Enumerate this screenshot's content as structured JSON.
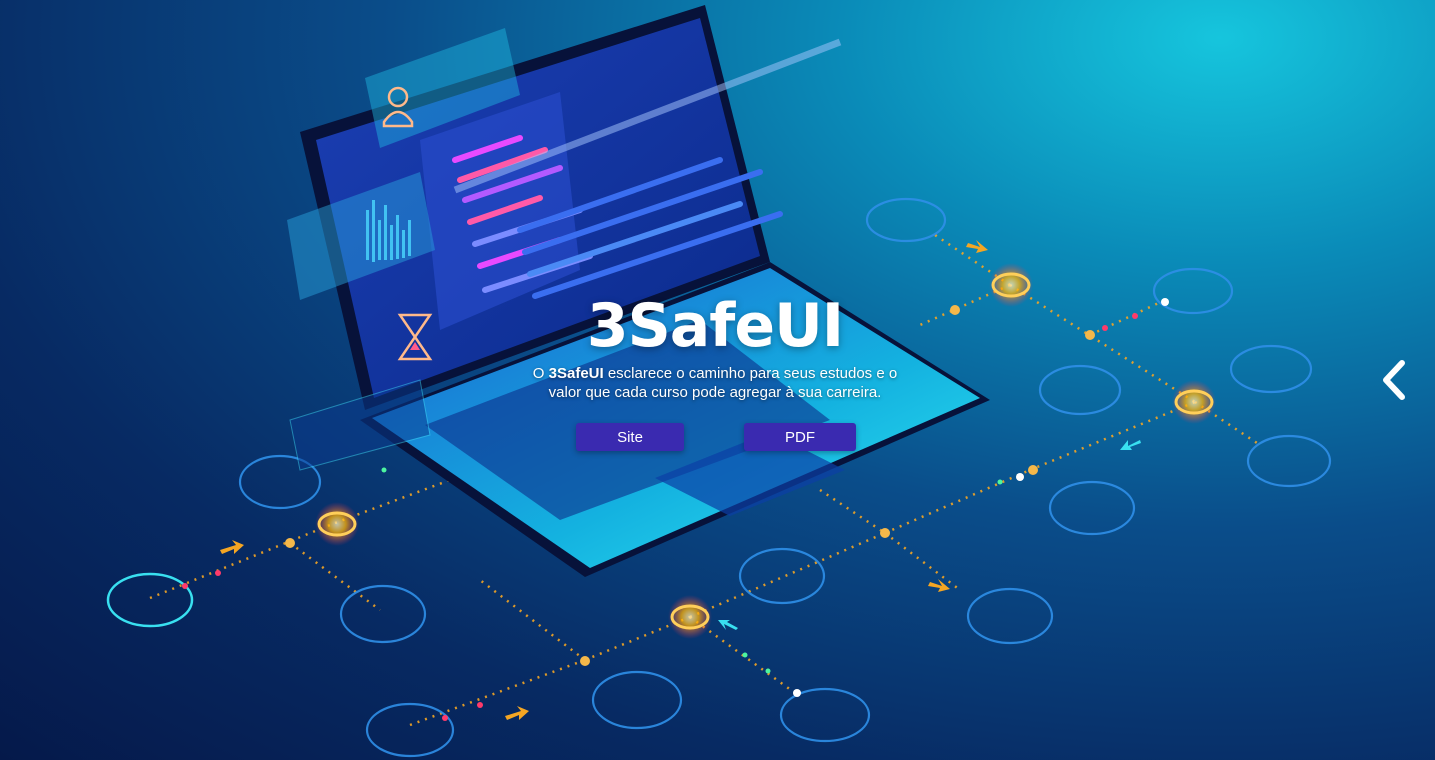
{
  "hero": {
    "title": "3SafeUI",
    "desc_prefix": "O ",
    "desc_brand": "3SafeUI",
    "desc_line1_rest": " esclarece o caminho para seus estudos e o",
    "desc_line2": "valor que cada curso pode agregar à sua carreira."
  },
  "buttons": {
    "site_label": "Site",
    "pdf_label": "PDF"
  },
  "carousel": {
    "arrow_icon": "chevron-left-icon"
  },
  "colors": {
    "button_bg": "#3a2ab0",
    "accent_cyan": "#2fe2f0",
    "accent_orange": "#f5a623"
  }
}
